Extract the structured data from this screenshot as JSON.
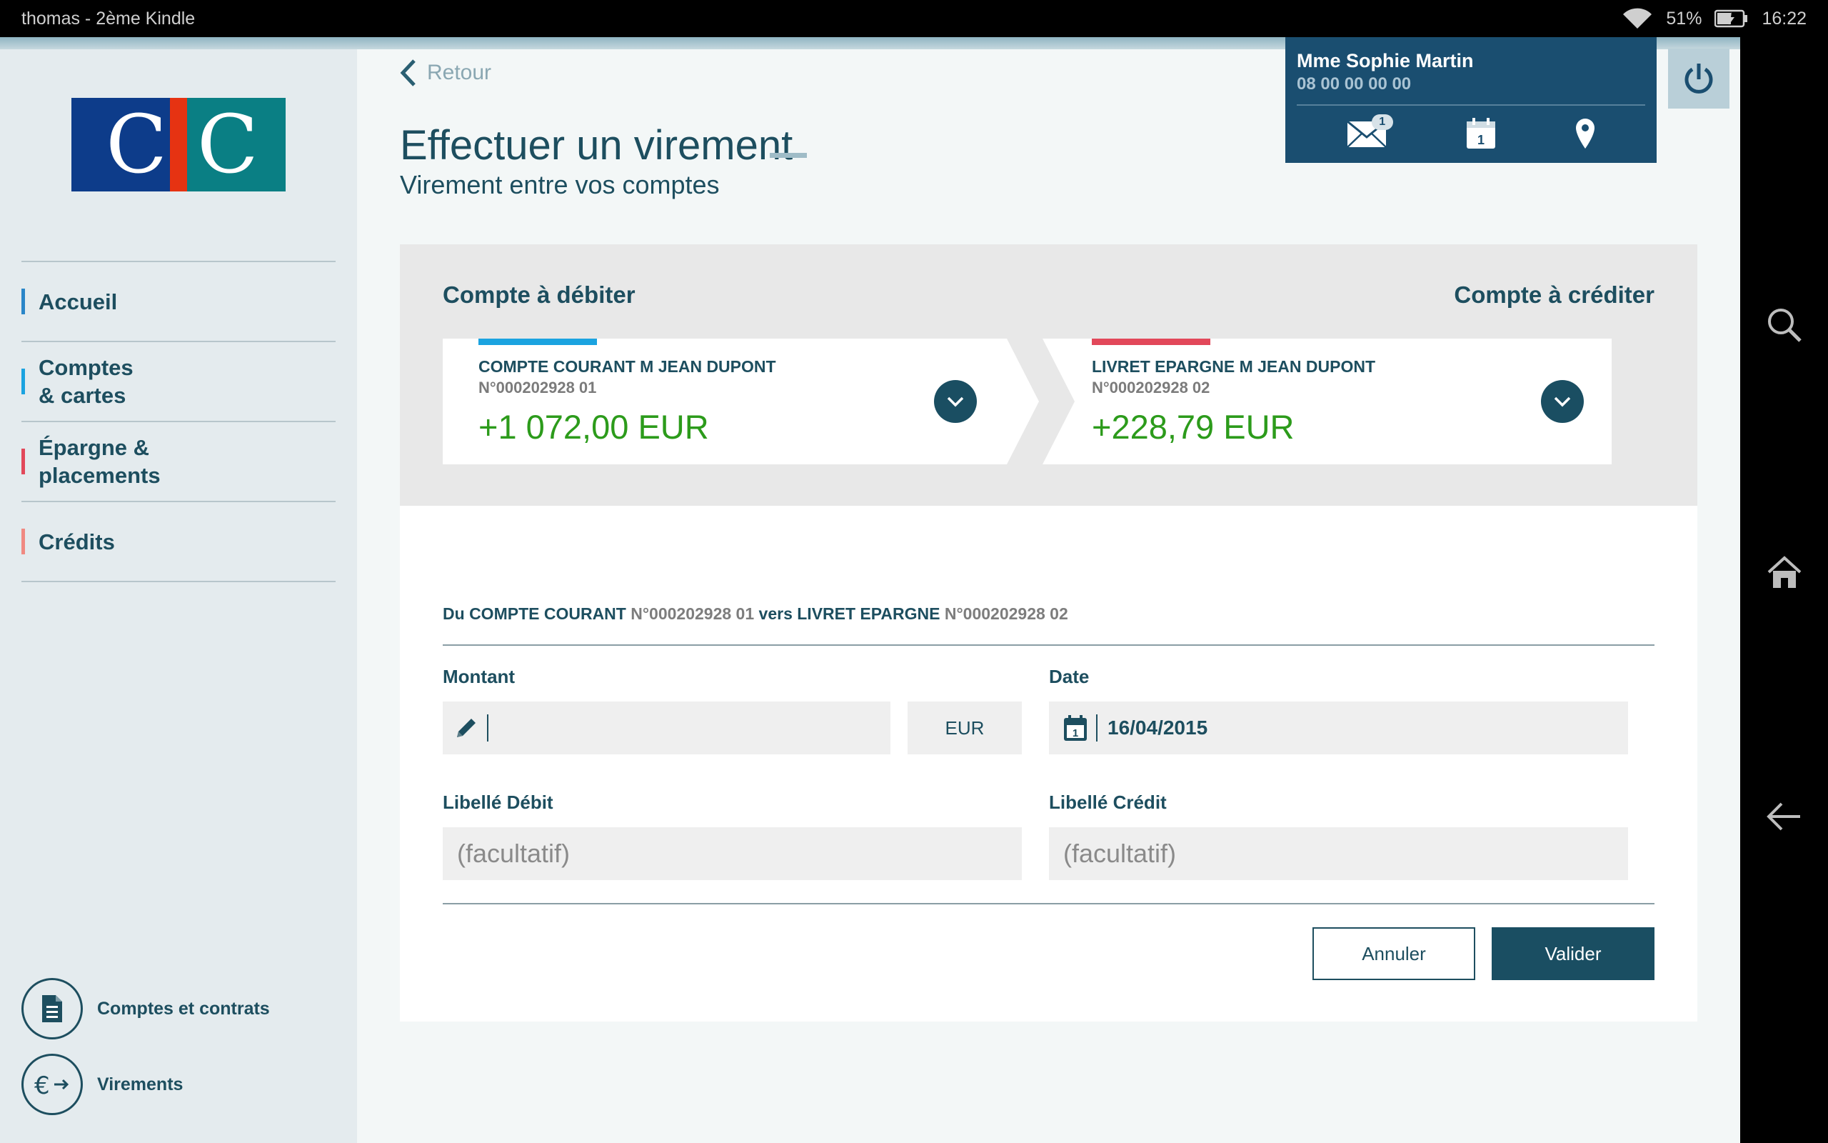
{
  "status_bar": {
    "title": "thomas - 2ème Kindle",
    "battery": "51%",
    "time": "16:22"
  },
  "brand": {
    "logo_letters": [
      "C",
      "C"
    ],
    "logo_colors": {
      "blue": "#0d3c8a",
      "red": "#e63312",
      "teal": "#0a7f84"
    }
  },
  "sidebar": {
    "items": [
      {
        "label": "Accueil",
        "color": "#2a86c8"
      },
      {
        "label": "Comptes\n& cartes",
        "color": "#1ba3e0"
      },
      {
        "label": "Épargne &\nplacements",
        "color": "#e2485a"
      },
      {
        "label": "Crédits",
        "color": "#f08a82"
      }
    ],
    "quick_links": [
      {
        "label": "Comptes et contrats",
        "icon": "document-icon"
      },
      {
        "label": "Virements",
        "icon": "euro-transfer-icon"
      }
    ]
  },
  "header": {
    "back_label": "Retour",
    "title": "Effectuer un virement",
    "subtitle": "Virement entre vos comptes"
  },
  "user": {
    "name": "Mme Sophie Martin",
    "phone": "08 00 00 00 00",
    "mail_badge": "1",
    "calendar_day": "1"
  },
  "accounts": {
    "debit_heading": "Compte à débiter",
    "credit_heading": "Compte à créditer",
    "debit": {
      "name": "COMPTE COURANT M JEAN DUPONT",
      "number": "N°000202928 01",
      "balance": "+1 072,00 EUR",
      "accent": "#1ba3e0"
    },
    "credit": {
      "name": "LIVRET EPARGNE M JEAN DUPONT",
      "number": "N°000202928 02",
      "balance": "+228,79 EUR",
      "accent": "#e2485a"
    }
  },
  "form": {
    "recap": {
      "from_prefix": "Du",
      "from_name": "COMPTE COURANT",
      "from_number": "N°000202928 01",
      "to_prefix": "vers",
      "to_name": "LIVRET EPARGNE",
      "to_number": "N°000202928 02"
    },
    "amount_label": "Montant",
    "amount_value": "",
    "currency": "EUR",
    "date_label": "Date",
    "date_value": "16/04/2015",
    "date_icon_day": "1",
    "debit_label_title": "Libellé Débit",
    "debit_label_placeholder": "(facultatif)",
    "credit_label_title": "Libellé Crédit",
    "credit_label_placeholder": "(facultatif)",
    "cancel": "Annuler",
    "submit": "Valider"
  }
}
